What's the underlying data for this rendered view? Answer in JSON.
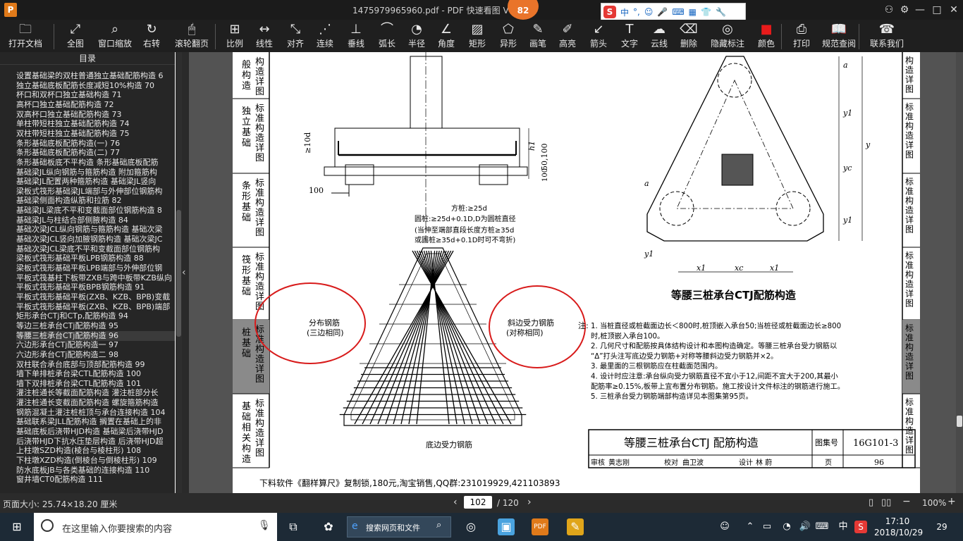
{
  "window": {
    "title": "1475979965960.pdf - PDF 快速看图 V",
    "badge": "82",
    "app_logo": "P"
  },
  "ime": {
    "letter": "S",
    "mode": "中",
    "punct": "°,"
  },
  "toolbar": {
    "items": [
      {
        "label": "打开文档",
        "icon": "folder-icon"
      },
      {
        "label": "全图",
        "icon": "fullscreen-icon"
      },
      {
        "label": "窗口缩放",
        "icon": "zoom-icon"
      },
      {
        "label": "右转",
        "icon": "rotate-icon"
      },
      {
        "label": "滚轮翻页",
        "icon": "mouse-icon"
      },
      {
        "label": "比例",
        "icon": "scale-icon"
      },
      {
        "label": "线性",
        "icon": "linear-measure-icon"
      },
      {
        "label": "对齐",
        "icon": "align-icon"
      },
      {
        "label": "连续",
        "icon": "continuous-icon"
      },
      {
        "label": "垂线",
        "icon": "perpendicular-icon"
      },
      {
        "label": "弧长",
        "icon": "arc-icon"
      },
      {
        "label": "半径",
        "icon": "radius-icon"
      },
      {
        "label": "角度",
        "icon": "angle-icon"
      },
      {
        "label": "矩形",
        "icon": "rectangle-icon"
      },
      {
        "label": "异形",
        "icon": "polygon-icon"
      },
      {
        "label": "画笔",
        "icon": "pen-icon"
      },
      {
        "label": "高亮",
        "icon": "highlight-icon"
      },
      {
        "label": "箭头",
        "icon": "arrow-icon"
      },
      {
        "label": "文字",
        "icon": "text-icon"
      },
      {
        "label": "云线",
        "icon": "cloud-icon"
      },
      {
        "label": "删除",
        "icon": "eraser-icon"
      },
      {
        "label": "隐藏标注",
        "icon": "eye-hide-icon"
      },
      {
        "label": "颜色",
        "icon": "color-swatch-icon"
      },
      {
        "label": "打印",
        "icon": "printer-icon"
      },
      {
        "label": "规范查阅",
        "icon": "book-icon"
      },
      {
        "label": "联系我们",
        "icon": "support-icon"
      }
    ],
    "color_swatch": "#e81b1b"
  },
  "sidebar": {
    "title": "目录",
    "items": [
      "设置基础梁的双柱普通独立基础配筋构造 6",
      "独立基础底板配筋长度减短10%构造 70",
      "杯口和双杯口独立基础构造 71",
      "高杯口独立基础配筋构造 72",
      "双高杯口独立基础配筋构造 73",
      "单柱带短柱独立基础配筋构造 74",
      "双柱带短柱独立基础配筋构造 75",
      "条形基础底板配筋构造(一) 76",
      "条形基础底板配筋构造(二) 77",
      "条形基础板底不平构造 条形基础底板配筋",
      "基础梁JL纵向钢筋与箍筋构造 附加箍筋构",
      "基础梁JL配置两种箍筋构造 基础梁JL竖向",
      "梁板式筏形基础梁JL端部与外伸部位钢筋构",
      "基础梁侧面构造纵筋和拉筋 82",
      "基础梁JL梁底不平和变截面部位钢筋构造 8",
      "基础梁JL与柱结合部侧腋构造 84",
      "基础次梁JCL纵向钢筋与箍筋构造 基础次梁",
      "基础次梁JCL竖向加腋钢筋构造 基础次梁JC",
      "基础次梁JCL梁底不平和变截面部位钢筋构",
      "梁板式筏形基础平板LPB钢筋构造 88",
      "梁板式筏形基础平板LPB端部与外伸部位钢",
      "平板式筏基柱下板带ZXB与跨中板带KZB纵向",
      "平板式筏形基础平板BPB钢筋构造 91",
      "平板式筏形基础平板(ZXB、KZB、BPB)变截",
      "平板式筏形基础平板(ZXB、KZB、BPB)端部",
      "矩形承台CTj和CTp,配筋构造 94",
      "等边三桩承台CTj配筋构造 95",
      "等腰三桩承台CTj配筋构造 96",
      "六边形承台CTj配筋构造一 97",
      "六边形承台CTj配筋构造二 98",
      "双柱联合承台底部与顶部配筋构造 99",
      "墙下单排桩承台梁CTL配筋构造 100",
      "墙下双排桩承台梁CTL配筋构造 101",
      "灌注桩通长等截面配筋构造 灌注桩部分长",
      "灌注桩通长变截面配筋构造 螺旋箍筋构造",
      "钢筋混凝土灌注桩桩顶与承台连接构造 104",
      "基础联系梁JLL配筋构造 搁置在基础上的非",
      "基础底板后浇带HJD构造 基础梁后浇带HJD",
      "后浇带HJD下抗水压垫层构造 后浇带HJD超",
      "上柱墩SZD构造(棱台与棱柱形) 108",
      "下柱墩XZD构造(倒棱台与倒棱柱形) 109",
      "防水底板JB与各类基础的连接构造 110",
      "窗井墙CT0配筋构造 111"
    ],
    "active_index": 27
  },
  "drawing": {
    "left_tabs": [
      {
        "cat": "般构造",
        "std": "构造详图"
      },
      {
        "cat": "独立基础",
        "std": "标准构造详图"
      },
      {
        "cat": "条形基础",
        "std": "标准构造详图"
      },
      {
        "cat": "筏形基础",
        "std": "标准构造详图"
      },
      {
        "cat": "桩基础",
        "std": "标准构造详图"
      },
      {
        "cat": "基础相关构造",
        "std": "标准构造详图"
      }
    ],
    "right_tabs": [
      "构造详图",
      "标准构造详图",
      "标准构造详图",
      "标准构造详图",
      "标准构造详图",
      "标准构造详图"
    ],
    "section_dims": {
      "d10": "≥10d",
      "d50": "50,100",
      "h1": "h1",
      "d100a": "100",
      "d100b": "100"
    },
    "pile_notes": [
      "方桩:≥25d",
      "圆桩:≥25d+0.1D,D为圆桩直径",
      "(当伸至端部直段长度方桩≥35d",
      "或圆桩≥35d+0.1D时可不弯折)"
    ],
    "labels": {
      "dist_rebar": "分布钢筋",
      "dist_rebar_sub": "(三边相同)",
      "slant_rebar": "斜边受力钢筋",
      "slant_rebar_sub": "(对称相同)",
      "bottom_rebar": "底边受力钢筋"
    },
    "plan_dims": {
      "a": "a",
      "a2": "a",
      "y1": "y1",
      "yc": "yc",
      "y1b": "y1",
      "y": "y",
      "x1": "x1",
      "xc": "xc",
      "x1b": "x1",
      "y1c": "y1"
    },
    "plan_title": "等腰三桩承台CTJ配筋构造",
    "notes_title": "注:",
    "notes": [
      "1. 当桩直径或桩截面边长＜800时,桩顶嵌入承台50;当桩径或桩截面边长≥800",
      "   时,桩顶嵌入承台100。",
      "2. 几何尺寸和配筋按具体结构设计和本图构造确定。等腰三桩承台受力钢筋以",
      "   “Δ”打头注写底边受力钢筋+对称等腰斜边受力钢筋并×2。",
      "3. 最里面的三根钢筋应在柱截面范围内。",
      "4. 设计时应注意:承台纵向受力钢筋直径不宜小于12,间距不宜大于200,其最小",
      "   配筋率≥0.15%,板带上宜布置分布钢筋。施工按设计文件标注的钢筋进行施工。",
      "5. 三桩承台受力钢筋端部构造详见本图集第95页。"
    ],
    "titleblock": {
      "title": "等腰三桩承台CTJ 配筋构造",
      "set_label": "图集号",
      "set_no": "16G101-3",
      "review": "审核",
      "reviewer": "黄志刚",
      "check": "校对",
      "checker": "曲卫波",
      "design": "设计",
      "designer": "林 蔚",
      "page_label": "页",
      "page_no": "96"
    },
    "footer": "下料软件《翻样算尺》复制锁,180元,淘宝销售,QQ群:231019929,421103893"
  },
  "status": {
    "page_size": "页面大小: 25.74×18.20 厘米",
    "current_page": "102",
    "total_pages": "/ 120",
    "zoom": "100%"
  },
  "taskbar": {
    "search_placeholder": "在这里输入你要搜索的内容",
    "edge_search": "搜索网页和文件",
    "lang": "中",
    "time": "17:10",
    "date": "2018/10/29",
    "notif": "29"
  }
}
